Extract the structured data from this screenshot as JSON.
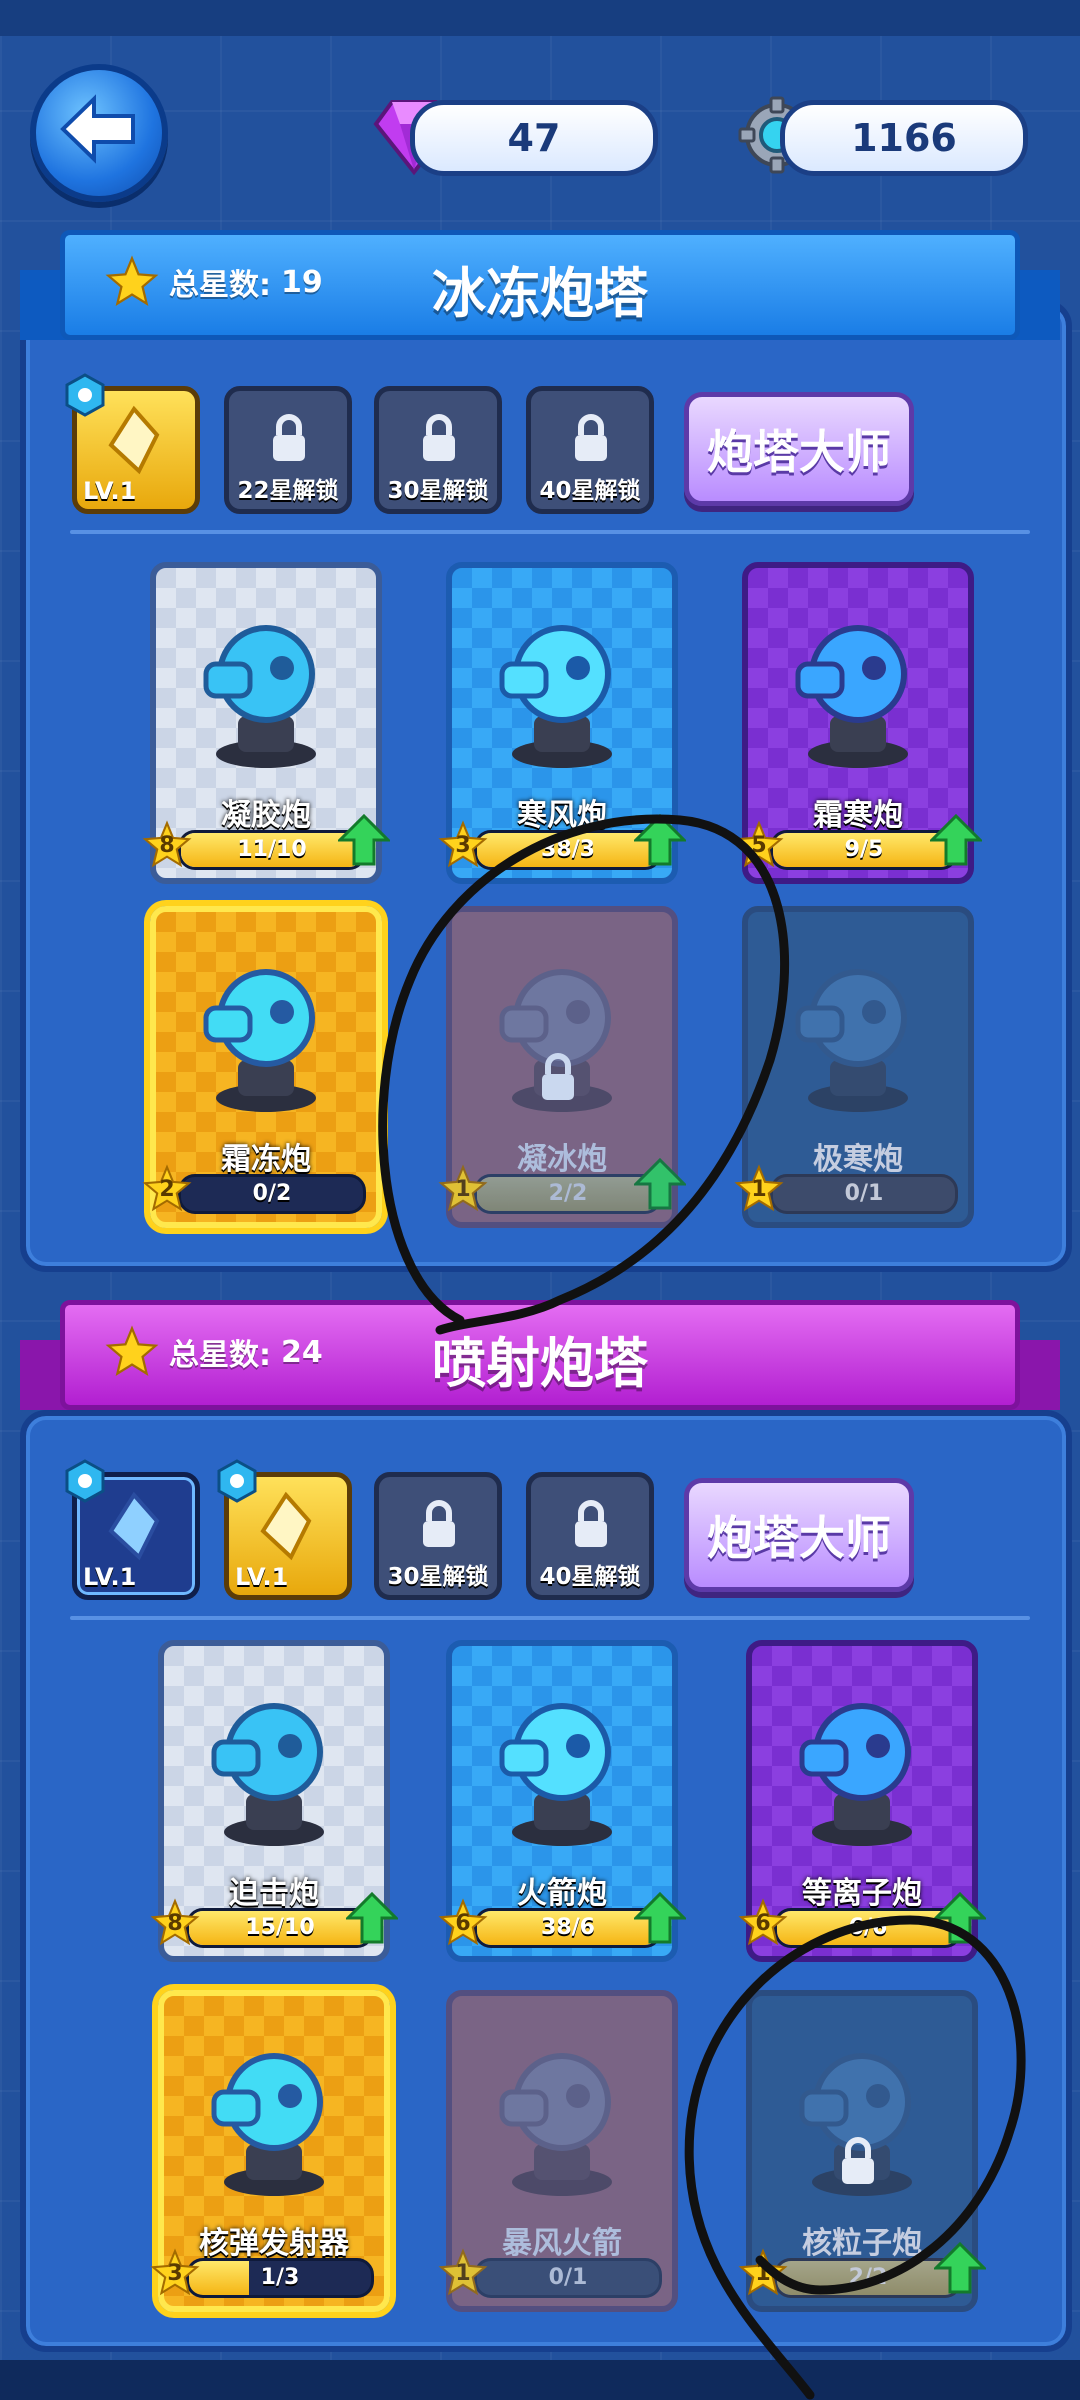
{
  "currency": {
    "gems": "47",
    "gears": "1166"
  },
  "sections": [
    {
      "title": "冰冻炮塔",
      "star_label": "总星数:",
      "star_total": "19",
      "skills": [
        {
          "type": "active",
          "level": "LV.1"
        },
        {
          "type": "locked",
          "label": "22星解锁"
        },
        {
          "type": "locked",
          "label": "30星解锁"
        },
        {
          "type": "locked",
          "label": "40星解锁"
        }
      ],
      "master_label": "炮塔大师",
      "cards": [
        {
          "name": "凝胶炮",
          "stars": "8",
          "progress": "11/10",
          "fill": 1.0,
          "style": "white",
          "upgrade": true
        },
        {
          "name": "寒风炮",
          "stars": "3",
          "progress": "38/3",
          "fill": 1.0,
          "style": "blue",
          "upgrade": true
        },
        {
          "name": "霜寒炮",
          "stars": "5",
          "progress": "9/5",
          "fill": 1.0,
          "style": "purple",
          "upgrade": true
        },
        {
          "name": "霜冻炮",
          "stars": "2",
          "progress": "0/2",
          "fill": 0.0,
          "style": "gold",
          "upgrade": false
        },
        {
          "name": "凝冰炮",
          "stars": "1",
          "progress": "2/2",
          "fill": 1.0,
          "style": "locked-red",
          "upgrade": true,
          "locked": true
        },
        {
          "name": "极寒炮",
          "stars": "1",
          "progress": "0/1",
          "fill": 0.0,
          "style": "locked-blue",
          "upgrade": false,
          "locked": false
        }
      ]
    },
    {
      "title": "喷射炮塔",
      "star_label": "总星数:",
      "star_total": "24",
      "skills": [
        {
          "type": "active-dark",
          "level": "LV.1"
        },
        {
          "type": "active",
          "level": "LV.1"
        },
        {
          "type": "locked",
          "label": "30星解锁"
        },
        {
          "type": "locked",
          "label": "40星解锁"
        }
      ],
      "master_label": "炮塔大师",
      "cards": [
        {
          "name": "迫击炮",
          "stars": "8",
          "progress": "15/10",
          "fill": 1.0,
          "style": "white",
          "upgrade": true
        },
        {
          "name": "火箭炮",
          "stars": "6",
          "progress": "38/6",
          "fill": 1.0,
          "style": "blue",
          "upgrade": true
        },
        {
          "name": "等离子炮",
          "stars": "6",
          "progress": "6/6",
          "fill": 1.0,
          "style": "purple",
          "upgrade": true
        },
        {
          "name": "核弹发射器",
          "stars": "3",
          "progress": "1/3",
          "fill": 0.33,
          "style": "gold",
          "upgrade": false
        },
        {
          "name": "暴风火箭",
          "stars": "1",
          "progress": "0/1",
          "fill": 0.0,
          "style": "locked-red",
          "upgrade": false,
          "locked": false
        },
        {
          "name": "核粒子炮",
          "stars": "1",
          "progress": "2/2",
          "fill": 1.0,
          "style": "locked-blue",
          "upgrade": true,
          "locked": true
        }
      ]
    }
  ]
}
